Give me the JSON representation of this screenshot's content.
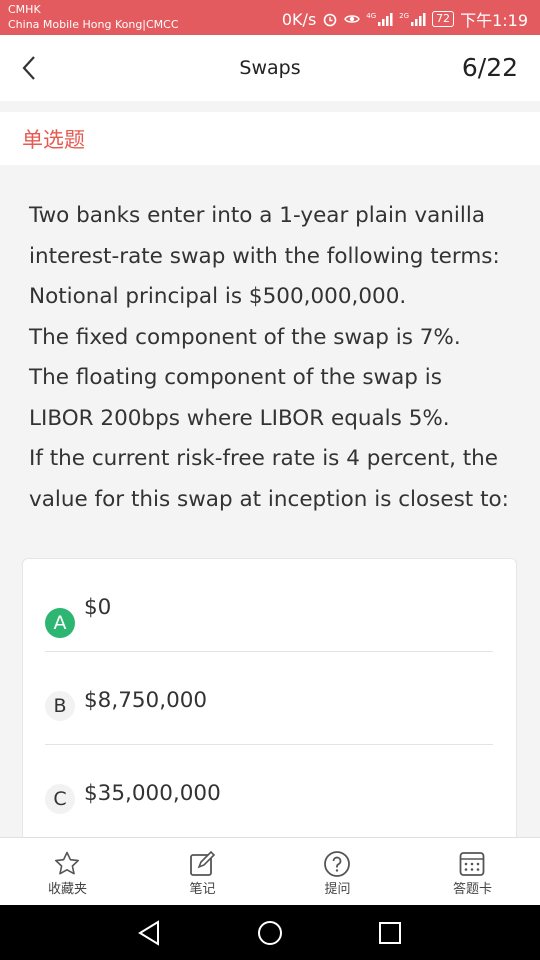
{
  "status_bar": {
    "carrier_line1": "CMHK",
    "carrier_line2": "China Mobile Hong Kong|CMCC",
    "speed": "0K/s",
    "signal1_label": "4G",
    "signal2_label": "2G",
    "battery": "72",
    "time": "下午1:19",
    "icons": [
      "alarm-icon",
      "eye-icon",
      "signal-icon",
      "signal-icon",
      "battery-icon"
    ]
  },
  "header": {
    "back_icon": "chevron-left-icon",
    "title": "Swaps",
    "counter": "6/22"
  },
  "question": {
    "type_label": "单选题",
    "stem_lines": [
      "Two banks enter into a 1-year plain vanilla",
      "interest-rate swap with the following terms:",
      "Notional principal is $500,000,000.",
      "The fixed component of the swap is 7%.",
      "The floating component of the swap is",
      "LIBOR 200bps where LIBOR equals 5%.",
      "If the current risk-free rate is 4 percent, the",
      "value for this swap at inception is closest to:"
    ],
    "options": [
      {
        "letter": "A",
        "text": "$0",
        "correct": true
      },
      {
        "letter": "B",
        "text": "$8,750,000",
        "correct": false
      },
      {
        "letter": "C",
        "text": "$35,000,000",
        "correct": false
      }
    ]
  },
  "toolbar": {
    "items": [
      {
        "label": "收藏夹",
        "icon": "star-icon"
      },
      {
        "label": "笔记",
        "icon": "note-edit-icon"
      },
      {
        "label": "提问",
        "icon": "question-icon"
      },
      {
        "label": "答题卡",
        "icon": "answer-card-icon"
      }
    ]
  },
  "colors": {
    "status_bar": "#e45b5f",
    "accent_red": "#e65a52",
    "correct_green": "#2db672"
  }
}
